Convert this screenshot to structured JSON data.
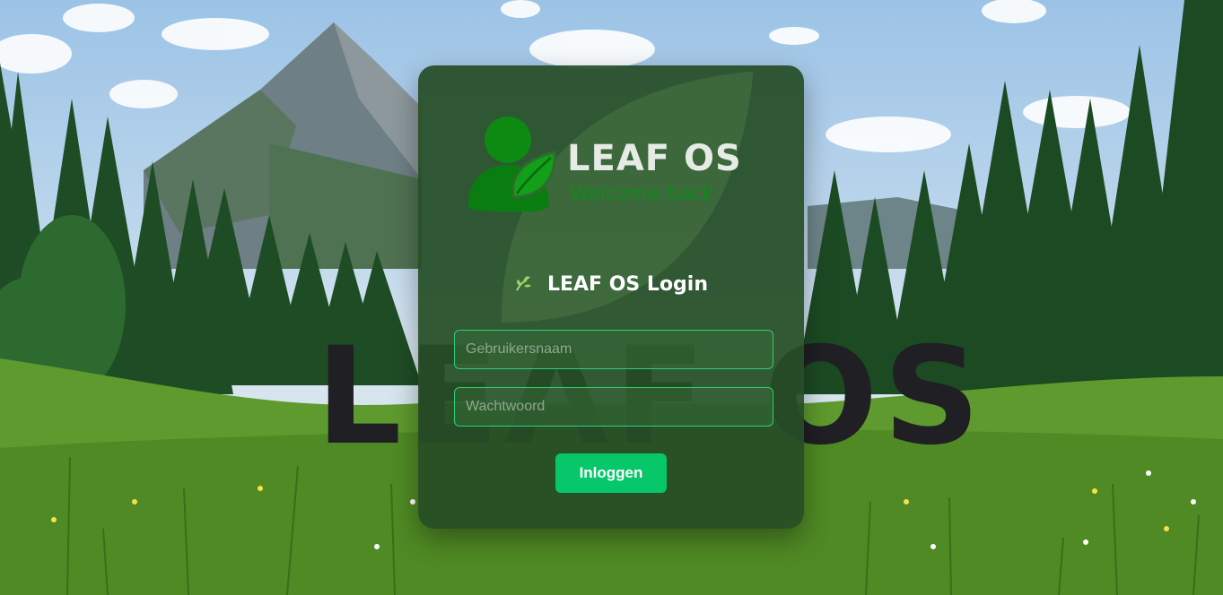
{
  "background": {
    "watermark_text": "LEAF OS"
  },
  "login_card": {
    "logo": {
      "name": "LEAF OS",
      "tagline": "Welcome back",
      "icon": "user-leaf-icon"
    },
    "title_icon": "sprout-icon",
    "title": "LEAF OS Login",
    "username_placeholder": "Gebruikersnaam",
    "username_value": "",
    "password_placeholder": "Wachtwoord",
    "password_value": "",
    "submit_label": "Inloggen"
  },
  "colors": {
    "card_background": "#264e26",
    "accent_green": "#06c76a",
    "field_border": "#2bd17a",
    "tagline_green": "#0f8a1a"
  }
}
